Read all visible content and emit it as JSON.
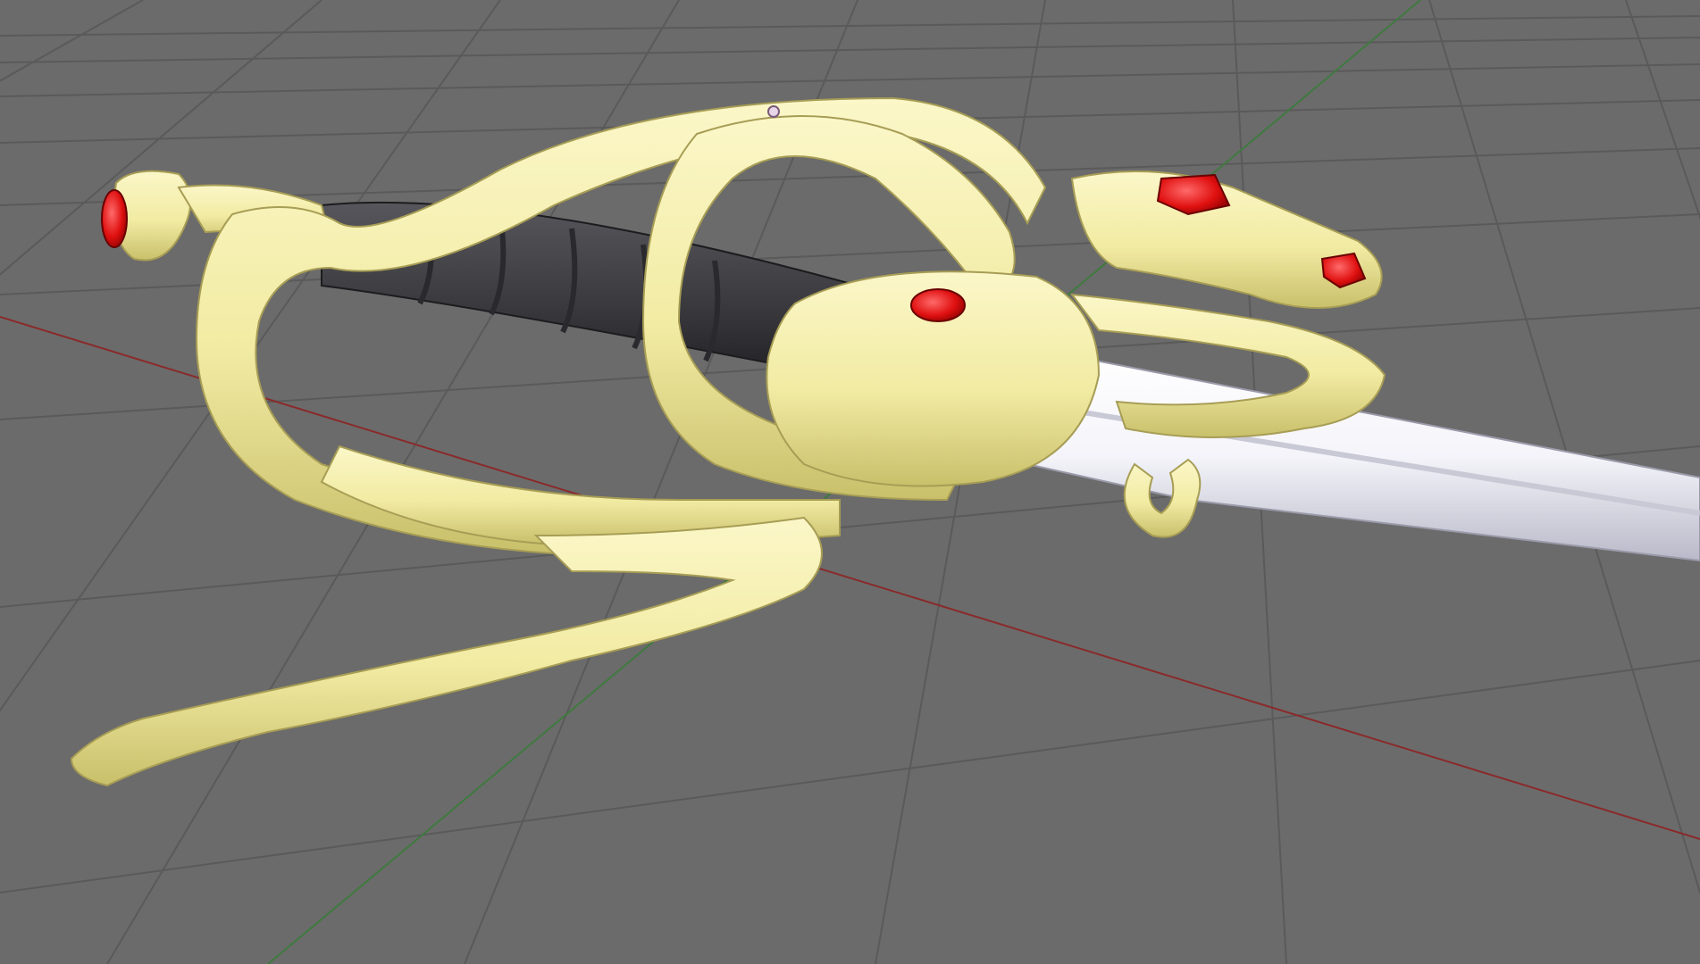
{
  "viewport": {
    "background_color": "#6b6b6b",
    "grid_color": "#5a5a5a",
    "x_axis_color": "#8a2a2a",
    "y_axis_color": "#3f7a3f",
    "grid_visible": true
  },
  "model": {
    "guard_color": "#f2eba3",
    "guard_shadow_color": "#c9c06b",
    "grip_color": "#3a3a3e",
    "blade_color": "#f4f4fa",
    "blade_shadow_color": "#b9b9c9",
    "gem_color": "#e01010"
  }
}
